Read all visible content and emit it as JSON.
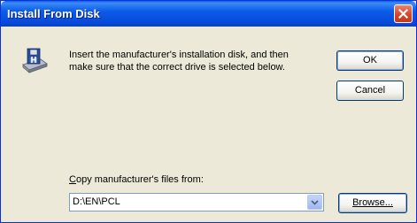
{
  "window": {
    "title": "Install From Disk"
  },
  "message": {
    "line1": "Insert the manufacturer's installation disk, and then",
    "line2": "make sure that the correct drive is selected below."
  },
  "buttons": {
    "ok": "OK",
    "cancel": "Cancel",
    "browse": "Browse..."
  },
  "copy_from": {
    "label_prefix": "C",
    "label_rest": "opy manufacturer's files from:",
    "value": "D:\\EN\\PCL"
  },
  "icons": {
    "disk": "install-disk-icon",
    "close": "close-icon",
    "dropdown": "chevron-down-icon"
  },
  "colors": {
    "titlebar": "#0A5DF0",
    "close": "#D6452A",
    "dialog_bg": "#ECE9D8"
  }
}
